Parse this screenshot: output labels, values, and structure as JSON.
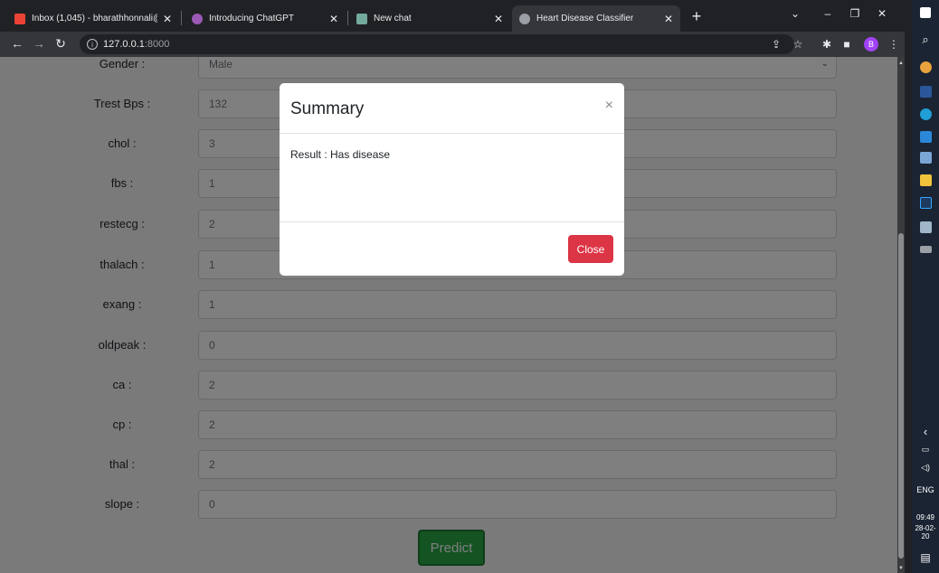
{
  "browser": {
    "tabs": [
      {
        "title": "Inbox (1,045) - bharathhonnali@",
        "favicon": "gmail-icon",
        "color": "#ea4335"
      },
      {
        "title": "Introducing ChatGPT",
        "favicon": "openai-icon",
        "color": "#9b59b6"
      },
      {
        "title": "New chat",
        "favicon": "chatgpt-icon",
        "color": "#74aa9c"
      },
      {
        "title": "Heart Disease Classifier",
        "favicon": "globe-icon",
        "color": "#9aa0a6"
      }
    ],
    "url_host": "127.0.0.1",
    "url_port": ":8000",
    "profile_initial": "B"
  },
  "form": {
    "fields": [
      {
        "label": "Gender :",
        "value": "Male"
      },
      {
        "label": "Trest Bps :",
        "value": "132"
      },
      {
        "label": "chol :",
        "value": "3"
      },
      {
        "label": "fbs :",
        "value": "1"
      },
      {
        "label": "restecg :",
        "value": "2"
      },
      {
        "label": "thalach :",
        "value": "1"
      },
      {
        "label": "exang :",
        "value": "1"
      },
      {
        "label": "oldpeak :",
        "value": "0"
      },
      {
        "label": "ca :",
        "value": "2"
      },
      {
        "label": "cp :",
        "value": "2"
      },
      {
        "label": "thal :",
        "value": "2"
      },
      {
        "label": "slope :",
        "value": "0"
      }
    ],
    "predict_label": "Predict"
  },
  "modal": {
    "title": "Summary",
    "close_x": "×",
    "body": "Result : Has disease",
    "close_label": "Close"
  },
  "taskbar": {
    "lang": "ENG",
    "time": "09:49",
    "date": "28-02-20"
  },
  "colors": {
    "predict": "#28a745",
    "close": "#dc3545",
    "active_tab": "#35363a"
  }
}
